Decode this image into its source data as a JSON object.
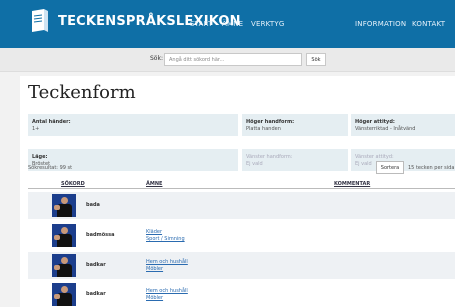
{
  "header": {
    "title": "TECKENSPRÅKSLEXIKON",
    "nav": {
      "start": "START",
      "amne": "ÄMNE",
      "verktyg": "VERKTYG",
      "information": "INFORMATION",
      "kontakt": "KONTAKT"
    }
  },
  "search": {
    "label": "Sök:",
    "placeholder": "Angå ditt sökord här...",
    "button": "Sök"
  },
  "page": {
    "title": "Teckenform"
  },
  "filters": {
    "antal_hander": {
      "label": "Antal händer:",
      "value": "1+"
    },
    "hoger_handform": {
      "label": "Höger handform:",
      "value": "Platta handen"
    },
    "hoger_attityd": {
      "label": "Höger attityd:",
      "value": "Vänsterriktad - Inåtvänd"
    },
    "lage": {
      "label": "Läge:",
      "value": "Bröstet"
    },
    "vanster_handform": {
      "label": "Vänster handform:",
      "value": "Ej vald"
    },
    "vanster_attityd": {
      "label": "Vänster attityd:",
      "value": "Ej vald"
    }
  },
  "results": {
    "count_text": "Sökresultat: 99 st",
    "sort_button": "Sortera",
    "per_page": "15 tecken per sida",
    "columns": {
      "sokord": "SÖKORD",
      "amne": "ÄMNE",
      "kommentar": "KOMMENTAR"
    },
    "rows": [
      {
        "word": "bada",
        "topics": []
      },
      {
        "word": "badmössa",
        "topics": [
          "Kläder",
          "Sport / Simning"
        ]
      },
      {
        "word": "badkar",
        "topics": [
          "Hem och hushåll",
          "Möbler"
        ]
      },
      {
        "word": "badkar",
        "topics": [
          "Hem och hushåll",
          "Möbler"
        ]
      }
    ]
  },
  "colors": {
    "brand": "#0f6fa6",
    "panel": "#e5eef2",
    "link": "#2a6bb0"
  }
}
